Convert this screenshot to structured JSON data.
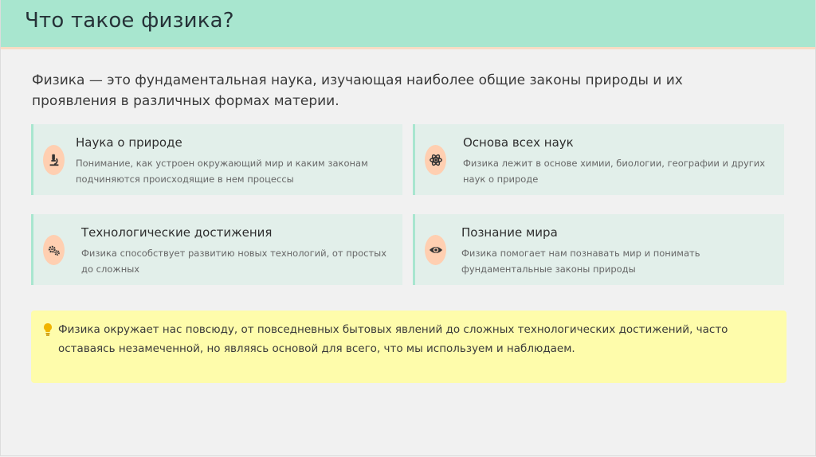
{
  "header": {
    "title": "Что такое физика?"
  },
  "intro": {
    "text": "Физика — это фундаментальная наука, изучающая наиболее общие законы природы и их проявления в различных формах материи."
  },
  "cards": [
    {
      "title": "Наука о природе",
      "desc": "Понимание, как устроен окружающий мир и каким законам подчиняются происходящие в нем процессы",
      "icon": "microscope-icon"
    },
    {
      "title": "Основа всех наук",
      "desc": "Физика лежит в основе химии, биологии, географии и других наук о природе",
      "icon": "atom-icon"
    },
    {
      "title": "Технологические достижения",
      "desc": "Физика способствует развитию новых технологий, от простых до сложных",
      "icon": "gears-icon"
    },
    {
      "title": "Познание мира",
      "desc": "Физика помогает нам познавать мир и понимать фундаментальные законы природы",
      "icon": "eye-icon"
    }
  ],
  "note": {
    "text": "Физика окружает нас повсюду, от повседневных бытовых явлений до сложных технологических достижений, часто оставаясь незамеченной, но являясь основой для всего, что мы используем и наблюдаем.",
    "icon": "lightbulb-icon"
  },
  "colors": {
    "header_bg": "#a8e6cf",
    "header_border": "#f7dcc4",
    "card_bg": "#e2efea",
    "icon_circle": "#ffcfb1",
    "note_bg": "#fefcab"
  }
}
